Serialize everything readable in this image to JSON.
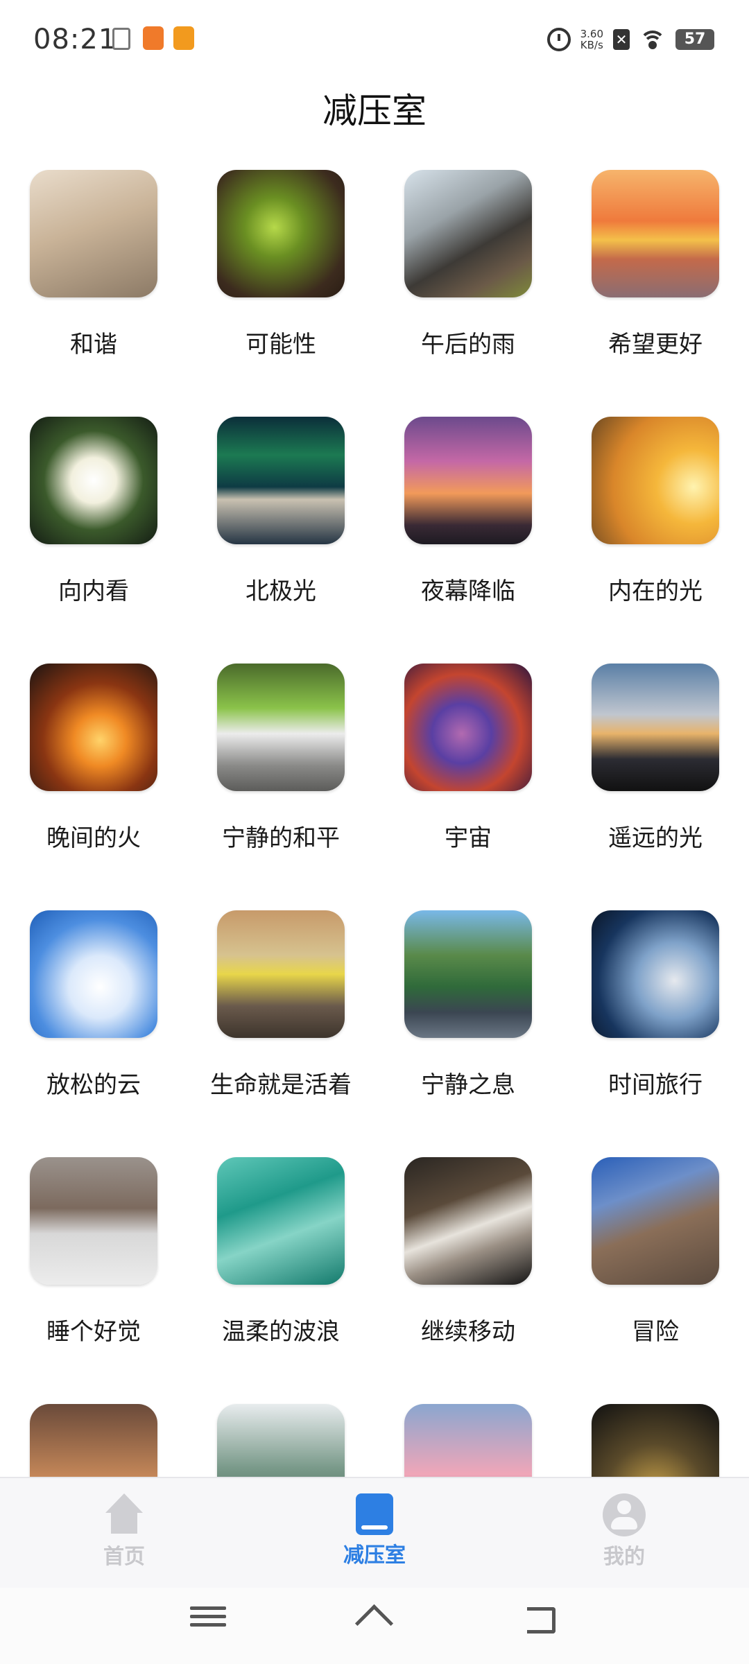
{
  "status_bar": {
    "time": "08:21",
    "net_speed_value": "3.60",
    "net_speed_unit": "KB/s",
    "battery": "57",
    "icons": [
      "doc-icon",
      "app-icon-1",
      "app-icon-2",
      "alarm-icon",
      "sim-icon",
      "wifi-icon",
      "battery-icon"
    ]
  },
  "page": {
    "title": "减压室"
  },
  "tiles": [
    {
      "label": "和谐",
      "gradient": "linear-gradient(160deg,#e9dccb 0%,#c9b398 45%,#8c7a66 100%)"
    },
    {
      "label": "可能性",
      "gradient": "radial-gradient(circle at 45% 45%,#b6d94a 0%,#6a8f22 30%,#3c2b1e 75%,#2a1d14 100%)"
    },
    {
      "label": "午后的雨",
      "gradient": "linear-gradient(150deg,#d7e2ea 0%,#9aa3a8 35%,#3d3a36 60%,#6b5a48 80%,#7f8b3a 100%)"
    },
    {
      "label": "希望更好",
      "gradient": "linear-gradient(180deg,#f6b46c 0%,#ef7a3c 40%,#f4c04a 55%,#c46a4a 70%,#8a6d73 100%)"
    },
    {
      "label": "向内看",
      "gradient": "radial-gradient(circle at 50% 50%,#ffffff 0%,#f2f0de 25%,#3b5a2b 55%,#141d14 100%)"
    },
    {
      "label": "北极光",
      "gradient": "linear-gradient(180deg,#0b2e3a 0%,#1c7a52 30%,#0e3b44 55%,#c9c1b1 65%,#253544 100%)"
    },
    {
      "label": "夜幕降临",
      "gradient": "linear-gradient(180deg,#6c4a8c 0%,#c468a6 35%,#f29a5a 60%,#3a2a35 85%,#1d1a22 100%)"
    },
    {
      "label": "内在的光",
      "gradient": "radial-gradient(circle at 80% 55%,#fff3b0 0%,#f5b73b 30%,#d9862a 65%,#6e4a22 100%)"
    },
    {
      "label": "晚间的火",
      "gradient": "radial-gradient(circle at 55% 60%,#ffd36a 0%,#f08a24 25%,#8a3512 55%,#1b1412 100%)"
    },
    {
      "label": "宁静的和平",
      "gradient": "linear-gradient(180deg,#4a6a2b 0%,#8bc34a 35%,#ececec 55%,#8a8a88 80%,#5c5c5a 100%)"
    },
    {
      "label": "宇宙",
      "gradient": "radial-gradient(circle at 45% 55%,#b26ab0 0%,#5a3fa3 30%,#c4452f 60%,#2b1640 100%)"
    },
    {
      "label": "遥远的光",
      "gradient": "linear-gradient(180deg,#5a7fa6 0%,#c0c6cf 40%,#e8b36a 55%,#2c2c33 75%,#111 100%)"
    },
    {
      "label": "放松的云",
      "gradient": "radial-gradient(circle at 55% 60%,#ffffff 0%,#dbe9fb 30%,#4d8ee0 65%,#1f5fb8 100%)"
    },
    {
      "label": "生命就是活着",
      "gradient": "linear-gradient(180deg,#c79a6a 0%,#d6c28f 35%,#e8d64a 50%,#6a5a4c 75%,#3d342c 100%)"
    },
    {
      "label": "宁静之息",
      "gradient": "linear-gradient(180deg,#79b8e8 0%,#5a8a4a 35%,#2f6a3a 60%,#3b4652 80%,#6a7684 100%)"
    },
    {
      "label": "时间旅行",
      "gradient": "radial-gradient(circle at 65% 55%,#e6e9ee 0%,#7fa2c9 35%,#17355e 70%,#0a1628 100%)"
    },
    {
      "label": "睡个好觉",
      "gradient": "linear-gradient(180deg,#9a928c 0%,#7c6a5e 40%,#d8d8d8 60%,#ececec 100%)"
    },
    {
      "label": "温柔的波浪",
      "gradient": "linear-gradient(160deg,#5fc7b8 0%,#1f9a8a 35%,#86d4c6 60%,#137a6c 100%)"
    },
    {
      "label": "继续移动",
      "gradient": "linear-gradient(160deg,#2a2622 0%,#5a4a3a 35%,#e7e3dc 55%,#9a8f84 70%,#141414 100%)"
    },
    {
      "label": "冒险",
      "gradient": "linear-gradient(160deg,#2a5fb8 0%,#6d8fc9 30%,#8a6e58 55%,#5a4a3e 100%)"
    },
    {
      "label": "",
      "gradient": "linear-gradient(180deg,#6a4a3a 0%,#c98a5a 60%,#f2d7a6 100%)"
    },
    {
      "label": "",
      "gradient": "linear-gradient(180deg,#e8ecee 0%,#7a9a8a 50%,#3a5a4a 100%)"
    },
    {
      "label": "",
      "gradient": "linear-gradient(180deg,#8aa6cf 0%,#f0a6b8 55%,#4a5a7a 100%)"
    },
    {
      "label": "",
      "gradient": "radial-gradient(circle at 50% 70%,#c9a24a 0%,#5a4a2a 45%,#111 100%)"
    }
  ],
  "bottom_nav": {
    "items": [
      {
        "label": "首页",
        "icon": "home-icon",
        "active": false
      },
      {
        "label": "减压室",
        "icon": "book-icon",
        "active": true
      },
      {
        "label": "我的",
        "icon": "user-icon",
        "active": false
      }
    ],
    "active_color": "#2d7fe3",
    "inactive_color": "#c8c8cc"
  },
  "system_nav": {
    "icons": [
      "menu-icon",
      "home-gesture-icon",
      "back-icon"
    ]
  }
}
